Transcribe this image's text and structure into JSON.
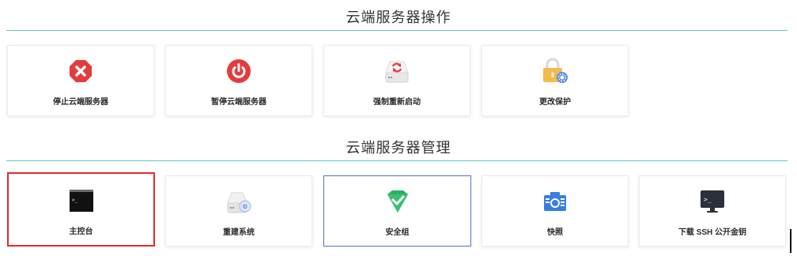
{
  "operations": {
    "title": "云端服务器操作",
    "cards": [
      {
        "label": "停止云端服务器",
        "icon": "stop-icon"
      },
      {
        "label": "暂停云端服务器",
        "icon": "power-icon"
      },
      {
        "label": "强制重新启动",
        "icon": "restart-icon"
      },
      {
        "label": "更改保护",
        "icon": "lock-settings-icon"
      }
    ]
  },
  "management": {
    "title": "云端服务器管理",
    "cards": [
      {
        "label": "主控台",
        "icon": "console-icon"
      },
      {
        "label": "重建系统",
        "icon": "rebuild-icon"
      },
      {
        "label": "安全组",
        "icon": "security-group-icon"
      },
      {
        "label": "快照",
        "icon": "camera-icon"
      },
      {
        "label": "下载 SSH 公开金钥",
        "icon": "ssh-terminal-icon"
      }
    ]
  },
  "colors": {
    "accent_teal": "#5fc9c0",
    "danger_red": "#e63b3b",
    "selected_red": "#e32b2b",
    "selected_blue": "#4a74c9",
    "green": "#3ab36b",
    "blue": "#3a7de0",
    "gold": "#f5b94a"
  }
}
